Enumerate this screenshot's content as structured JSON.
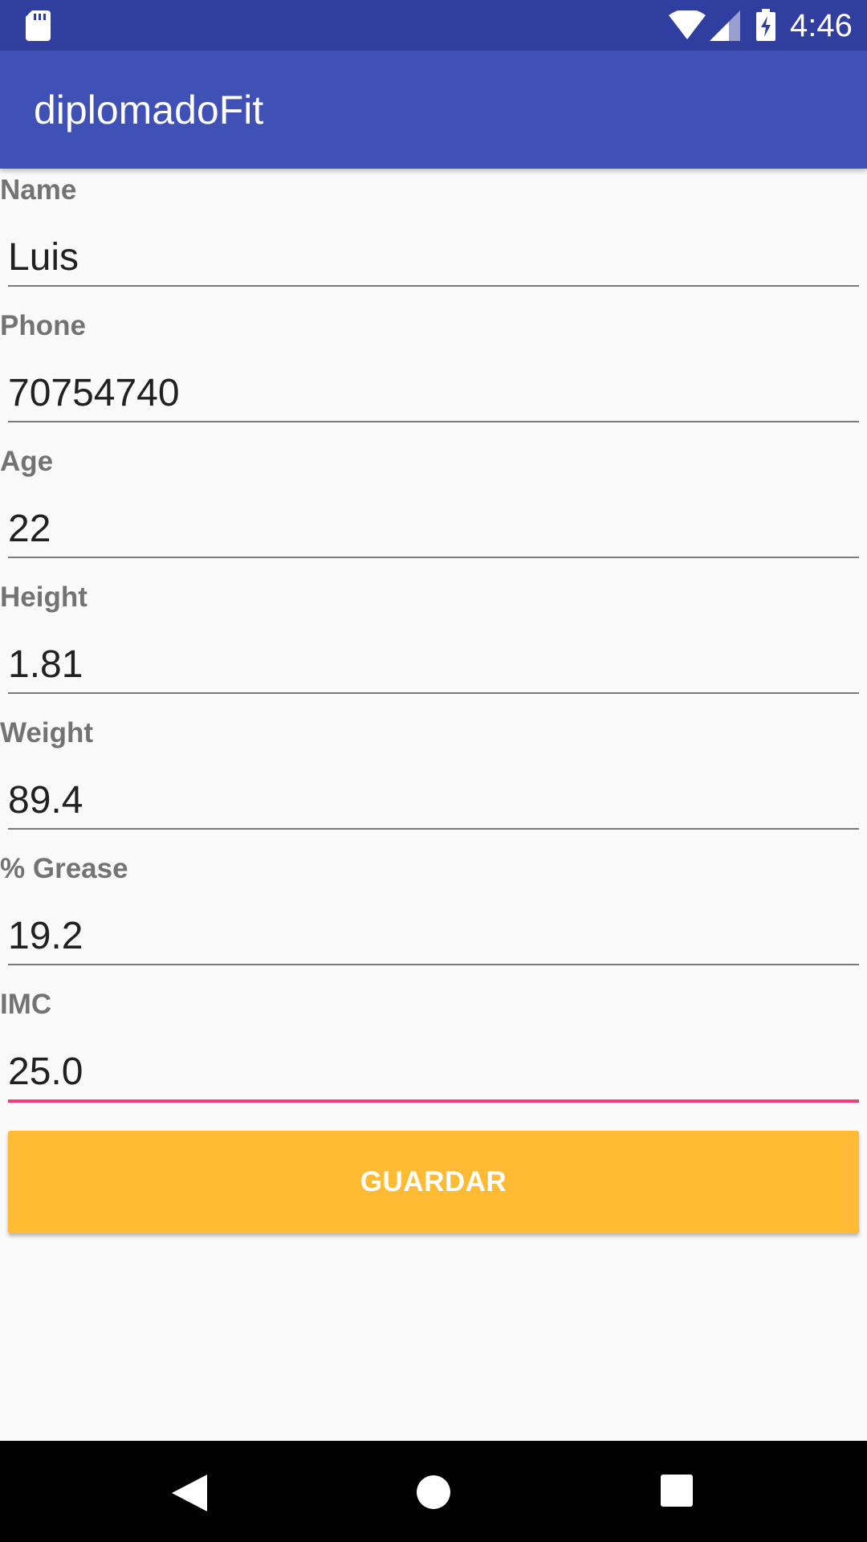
{
  "status_bar": {
    "time": "4:46",
    "icons": [
      "sd-card-icon",
      "wifi-icon",
      "signal-icon",
      "battery-charging-icon"
    ],
    "color": "#303f9f"
  },
  "app_bar": {
    "title": "diplomadoFit",
    "color": "#3f51b5"
  },
  "form": {
    "fields": [
      {
        "label": "Name",
        "value": "Luis"
      },
      {
        "label": "Phone",
        "value": "70754740"
      },
      {
        "label": "Age",
        "value": "22"
      },
      {
        "label": "Height",
        "value": "1.81"
      },
      {
        "label": "Weight",
        "value": "89.4"
      },
      {
        "label": "% Grease",
        "value": "19.2"
      },
      {
        "label": "IMC",
        "value": "25.0"
      }
    ],
    "focused_field": "IMC",
    "focus_color": "#ec407a"
  },
  "save_button": {
    "label": "GUARDAR",
    "color": "#ffbb33"
  },
  "nav_bar": {
    "icons": [
      "back-icon",
      "home-icon",
      "recents-icon"
    ]
  }
}
